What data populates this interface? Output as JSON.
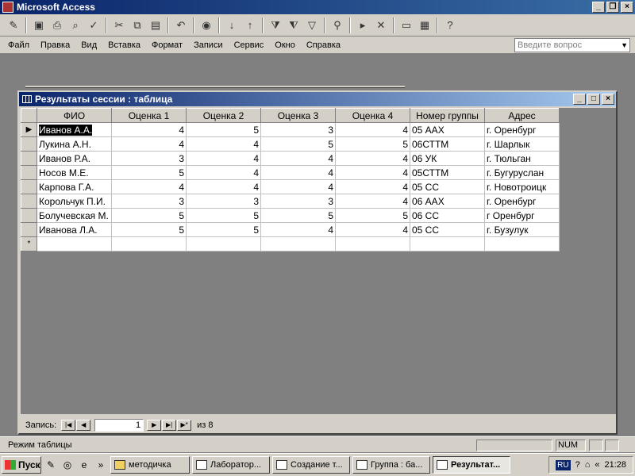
{
  "app": {
    "title": "Microsoft Access"
  },
  "window_buttons": {
    "minimize": "_",
    "restore": "❐",
    "close": "×"
  },
  "menu": [
    "Файл",
    "Правка",
    "Вид",
    "Вставка",
    "Формат",
    "Записи",
    "Сервис",
    "Окно",
    "Справка"
  ],
  "help_box": {
    "placeholder": "Введите вопрос"
  },
  "table_window": {
    "title": "Результаты сессии : таблица",
    "columns": [
      "ФИО",
      "Оценка 1",
      "Оценка 2",
      "Оценка 3",
      "Оценка 4",
      "Номер группы",
      "Адрес"
    ],
    "rows": [
      [
        "Иванов А.А.",
        "4",
        "5",
        "3",
        "4",
        "05 ААХ",
        "г. Оренбург"
      ],
      [
        "Лукина А.Н.",
        "4",
        "4",
        "5",
        "5",
        "06СТТМ",
        "г. Шарлык"
      ],
      [
        "Иванов Р.А.",
        "3",
        "4",
        "4",
        "4",
        "06 УК",
        "г. Тюльган"
      ],
      [
        "Носов М.Е.",
        "5",
        "4",
        "4",
        "4",
        "05СТТМ",
        "г. Бугуруслан"
      ],
      [
        "Карпова Г.А.",
        "4",
        "4",
        "4",
        "4",
        "05 СС",
        "г. Новотроицк"
      ],
      [
        "Корольчук П.И.",
        "3",
        "3",
        "3",
        "4",
        "06 ААХ",
        "г. Оренбург"
      ],
      [
        "Болучевская М.",
        "5",
        "5",
        "5",
        "5",
        "06 СС",
        "г Оренбург"
      ],
      [
        "Иванова Л.А.",
        "5",
        "5",
        "4",
        "4",
        "05 СС",
        "г. Бузулук"
      ]
    ],
    "new_row_marker": "*",
    "current_row_marker": "▶"
  },
  "record_nav": {
    "label": "Запись:",
    "current": "1",
    "of_label": "из 8"
  },
  "status": {
    "mode": "Режим таблицы",
    "num": "NUM"
  },
  "taskbar": {
    "start": "Пуск",
    "tasks": [
      "методичка",
      "Лаборатор...",
      "Создание т...",
      "Группа : ба...",
      "Результат..."
    ],
    "lang": "RU",
    "time": "21:28"
  }
}
